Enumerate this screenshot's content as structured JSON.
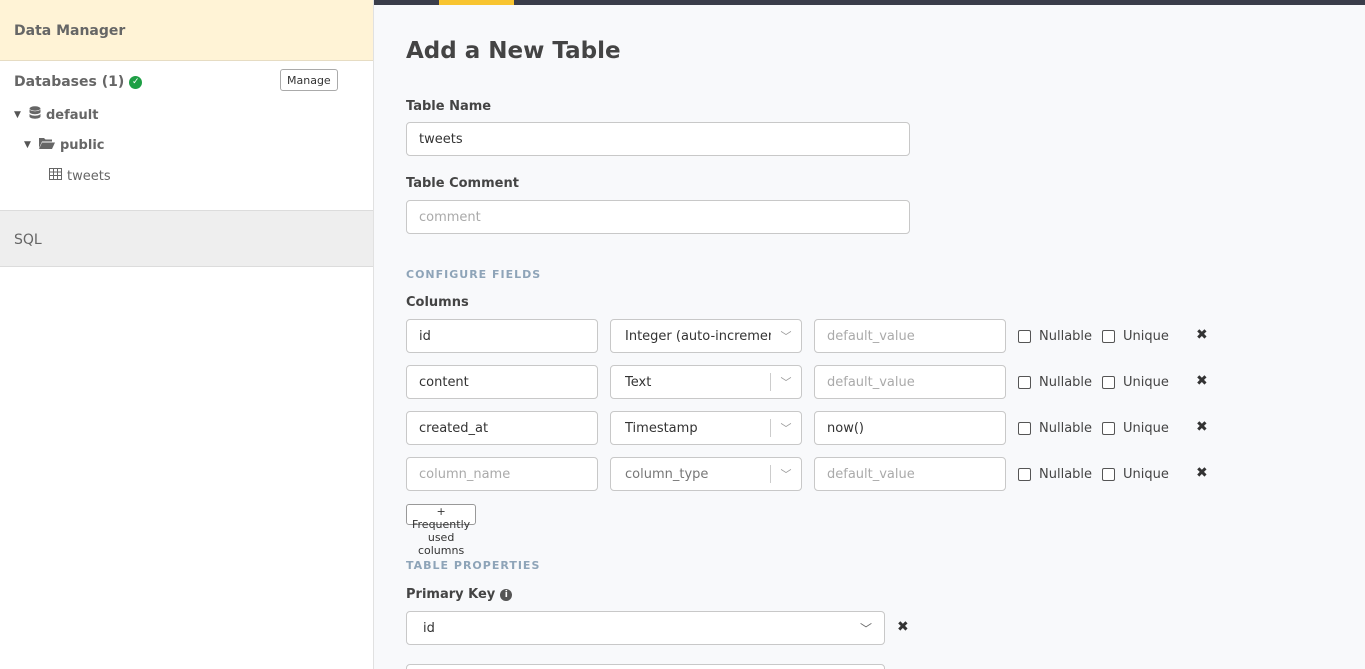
{
  "sidebar": {
    "header": "Data Manager",
    "databases_label": "Databases (1)",
    "manage_label": "Manage",
    "tree": {
      "db": "default",
      "schema": "public",
      "table": "tweets"
    },
    "sql_label": "SQL"
  },
  "main": {
    "title": "Add a New Table",
    "table_name_label": "Table Name",
    "table_name_value": "tweets",
    "table_comment_label": "Table Comment",
    "table_comment_placeholder": "comment",
    "configure_fields_heading": "CONFIGURE FIELDS",
    "columns_label": "Columns",
    "columns": [
      {
        "name": "id",
        "type": "Integer (auto-increment)",
        "default": "",
        "default_placeholder": "default_value",
        "name_placeholder": "column_name"
      },
      {
        "name": "content",
        "type": "Text",
        "default": "",
        "default_placeholder": "default_value",
        "name_placeholder": "column_name"
      },
      {
        "name": "created_at",
        "type": "Timestamp",
        "default": "now()",
        "default_placeholder": "default_value",
        "name_placeholder": "column_name"
      },
      {
        "name": "",
        "type": "column_type",
        "default": "",
        "default_placeholder": "default_value",
        "name_placeholder": "column_name"
      }
    ],
    "nullable_label": "Nullable",
    "unique_label": "Unique",
    "frequent_columns_label": "+ Frequently used columns",
    "table_properties_heading": "TABLE PROPERTIES",
    "primary_key_label": "Primary Key",
    "primary_key_value": "id"
  },
  "colors": {
    "accent": "#f8c430",
    "topbar": "#3a3d4a",
    "sidebar_header_bg": "#fff3d6",
    "success": "#1e9f45",
    "section_heading": "#8ea4b8"
  },
  "icons": {
    "database": "database-icon",
    "folder": "folder-open-icon",
    "table": "table-icon",
    "check": "check-circle-icon",
    "remove": "times-icon",
    "info": "info-circle-icon"
  }
}
